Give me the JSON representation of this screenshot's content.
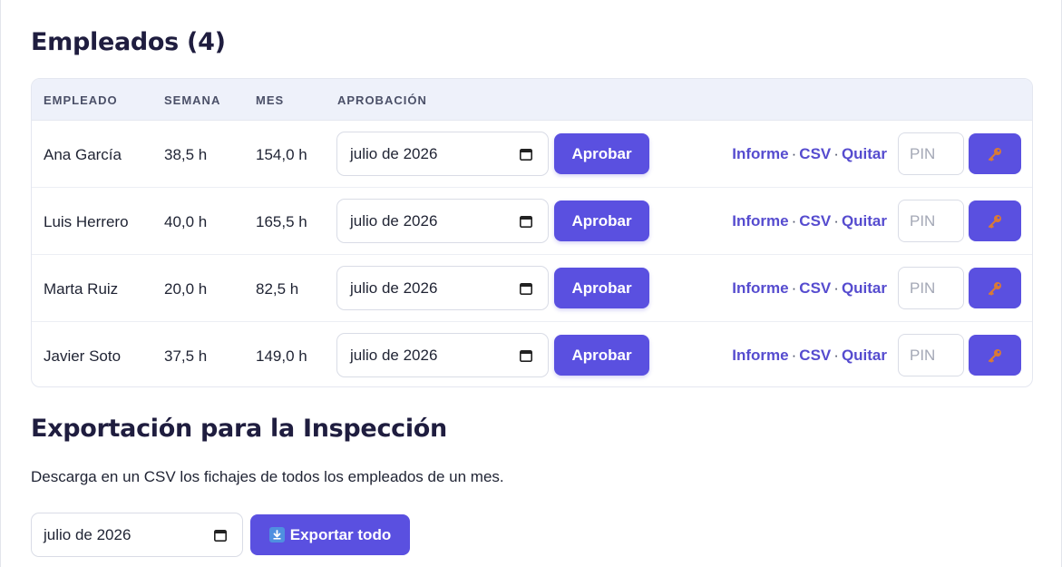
{
  "employees_section": {
    "title": "Empleados (4)",
    "columns": {
      "employee": "EMPLEADO",
      "week": "SEMANA",
      "month": "MES",
      "approval": "APROBACIÓN"
    },
    "rows": [
      {
        "name": "Ana García",
        "week": "38,5 h",
        "month": "154,0 h",
        "month_value": "julio de 2026",
        "approve_label": "Aprobar",
        "report": "Informe",
        "csv": "CSV",
        "remove": "Quitar",
        "pin_placeholder": "PIN"
      },
      {
        "name": "Luis Herrero",
        "week": "40,0 h",
        "month": "165,5 h",
        "month_value": "julio de 2026",
        "approve_label": "Aprobar",
        "report": "Informe",
        "csv": "CSV",
        "remove": "Quitar",
        "pin_placeholder": "PIN"
      },
      {
        "name": "Marta Ruiz",
        "week": "20,0 h",
        "month": "82,5 h",
        "month_value": "julio de 2026",
        "approve_label": "Aprobar",
        "report": "Informe",
        "csv": "CSV",
        "remove": "Quitar",
        "pin_placeholder": "PIN"
      },
      {
        "name": "Javier Soto",
        "week": "37,5 h",
        "month": "149,0 h",
        "month_value": "julio de 2026",
        "approve_label": "Aprobar",
        "report": "Informe",
        "csv": "CSV",
        "remove": "Quitar",
        "pin_placeholder": "PIN"
      }
    ],
    "separator": "·"
  },
  "export_section": {
    "title": "Exportación para la Inspección",
    "description": "Descarga en un CSV los fichajes de todos los empleados de un mes.",
    "month_value": "julio de 2026",
    "export_label": "Exportar todo"
  },
  "colors": {
    "accent": "#5a50e0",
    "link": "#564ccf",
    "header_bg": "#eef1fa"
  },
  "icons": {
    "date": "calendar-icon",
    "key": "key-icon",
    "download": "download-icon"
  }
}
